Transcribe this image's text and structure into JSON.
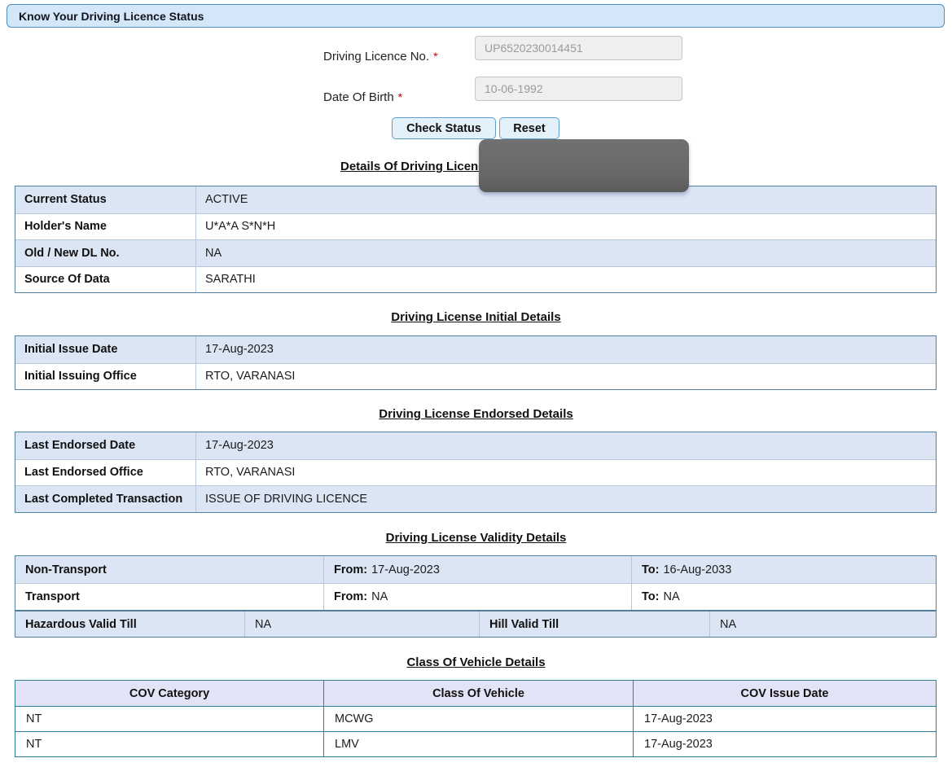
{
  "page": {
    "title": "Know Your Driving Licence Status"
  },
  "form": {
    "fields": [
      {
        "label": "Driving Licence No.",
        "required_mark": "*",
        "value": "UP6520230014451"
      },
      {
        "label": "Date Of Birth",
        "required_mark": "*",
        "value": "10-06-1992"
      }
    ],
    "buttons": {
      "check_status": "Check Status",
      "reset": "Reset"
    }
  },
  "sections": {
    "holder": {
      "heading": "Details Of Driving Licence",
      "rows": [
        {
          "label": "Current Status",
          "value": "ACTIVE"
        },
        {
          "label": "Holder's Name",
          "value": "U*A*A S*N*H"
        },
        {
          "label": "Old / New DL No.",
          "value": "NA"
        },
        {
          "label": "Source Of Data",
          "value": "SARATHI"
        }
      ]
    },
    "initial": {
      "heading": "Driving License Initial Details",
      "rows": [
        {
          "label": "Initial Issue Date",
          "value": "17-Aug-2023"
        },
        {
          "label": "Initial Issuing Office",
          "value": "RTO, VARANASI"
        }
      ]
    },
    "endorsed": {
      "heading": "Driving License Endorsed Details",
      "rows": [
        {
          "label": "Last Endorsed Date",
          "value": "17-Aug-2023"
        },
        {
          "label": "Last Endorsed Office",
          "value": "RTO, VARANASI"
        },
        {
          "label": "Last Completed Transaction",
          "value": "ISSUE OF DRIVING LICENCE"
        }
      ]
    },
    "validity": {
      "heading": "Driving License Validity Details",
      "rows": [
        {
          "label": "Non-Transport",
          "from_label": "From:",
          "from": "17-Aug-2023",
          "to_label": "To:",
          "to": "16-Aug-2033"
        },
        {
          "label": "Transport",
          "from_label": "From:",
          "from": "NA",
          "to_label": "To:",
          "to": "NA"
        }
      ],
      "extra": {
        "label1": "Hazardous Valid Till",
        "value1": "NA",
        "label2": "Hill Valid Till",
        "value2": "NA"
      }
    },
    "cov": {
      "heading": "Class Of Vehicle Details",
      "columns": [
        "COV Category",
        "Class Of Vehicle",
        "COV Issue Date"
      ],
      "rows": [
        {
          "category": "NT",
          "vehicle_class": "MCWG",
          "issue_date": "17-Aug-2023"
        },
        {
          "category": "NT",
          "vehicle_class": "LMV",
          "issue_date": "17-Aug-2023"
        }
      ]
    }
  },
  "colors": {
    "header_bg": "#d3e7f8",
    "header_border": "#4a90c8",
    "alt_row_bg": "#dbe5f4",
    "table_border": "#54809f",
    "cov_border": "#2e7f99",
    "cov_header_bg": "#e3e3f7",
    "required_mark": "#cc0000",
    "redaction_overlay": "#676767"
  }
}
